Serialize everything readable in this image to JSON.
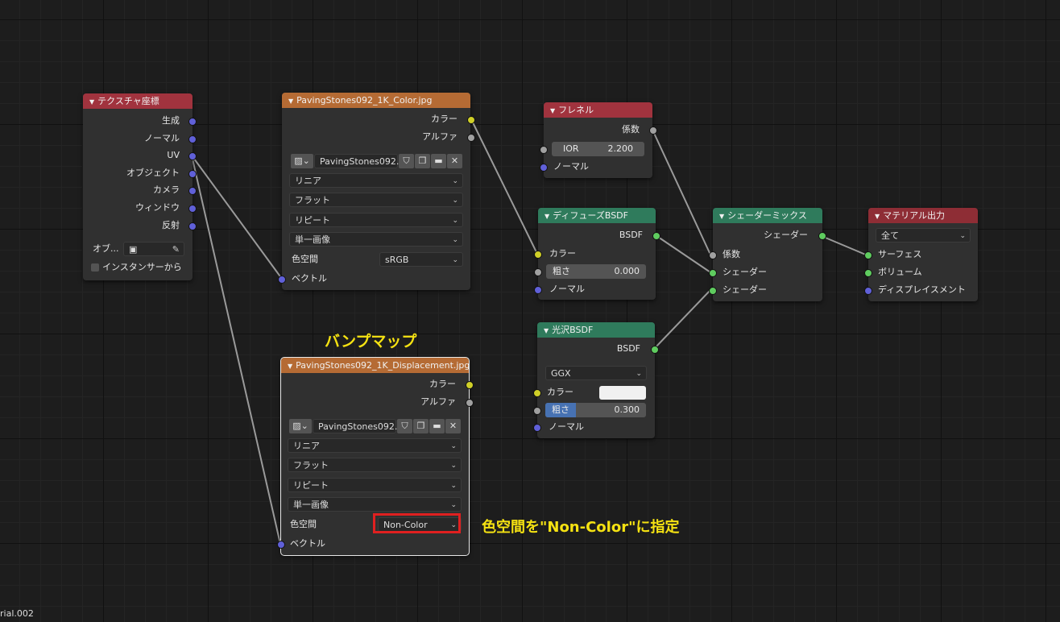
{
  "colors": {
    "header_tex_coord": "#a1333e",
    "header_image": "#b56b34",
    "header_shader": "#2f7b5c",
    "header_output": "#8e2d35",
    "annotation": "#f5e212",
    "highlight_box": "#e02020"
  },
  "tex_coord": {
    "title": "テクスチャ座標",
    "outputs": [
      "生成",
      "ノーマル",
      "UV",
      "オブジェクト",
      "カメラ",
      "ウィンドウ",
      "反射"
    ],
    "object_label": "オブ...",
    "instancer_label": "インスタンサーから"
  },
  "image1": {
    "title": "PavingStones092_1K_Color.jpg",
    "outputs": [
      "カラー",
      "アルファ"
    ],
    "image_name": "PavingStones092...",
    "interpolation": "リニア",
    "projection": "フラット",
    "extension": "リピート",
    "source": "単一画像",
    "colorspace_label": "色空間",
    "colorspace": "sRGB",
    "vector_label": "ベクトル"
  },
  "image2": {
    "title": "PavingStones092_1K_Displacement.jpg",
    "outputs": [
      "カラー",
      "アルファ"
    ],
    "image_name": "PavingStones092...",
    "interpolation": "リニア",
    "projection": "フラット",
    "extension": "リピート",
    "source": "単一画像",
    "colorspace_label": "色空間",
    "colorspace": "Non-Color",
    "vector_label": "ベクトル"
  },
  "fresnel": {
    "title": "フレネル",
    "output": "係数",
    "ior_label": "IOR",
    "ior_value": "2.200",
    "normal_label": "ノーマル"
  },
  "diffuse": {
    "title": "ディフューズBSDF",
    "output": "BSDF",
    "color_label": "カラー",
    "rough_label": "粗さ",
    "rough_value": "0.000",
    "normal_label": "ノーマル"
  },
  "glossy": {
    "title": "光沢BSDF",
    "output": "BSDF",
    "distribution": "GGX",
    "color_label": "カラー",
    "rough_label": "粗さ",
    "rough_value": "0.300",
    "rough_fill": 0.3,
    "normal_label": "ノーマル"
  },
  "mix": {
    "title": "シェーダーミックス",
    "output": "シェーダー",
    "fac_label": "係数",
    "shader1_label": "シェーダー",
    "shader2_label": "シェーダー"
  },
  "output": {
    "title": "マテリアル出力",
    "target": "全て",
    "surface_label": "サーフェス",
    "volume_label": "ボリューム",
    "displacement_label": "ディスプレイスメント"
  },
  "annotations": {
    "bump_map": "バンプマップ",
    "colorspace_note": "色空間を\"Non-Color\"に指定"
  },
  "material_name": "rial.002"
}
